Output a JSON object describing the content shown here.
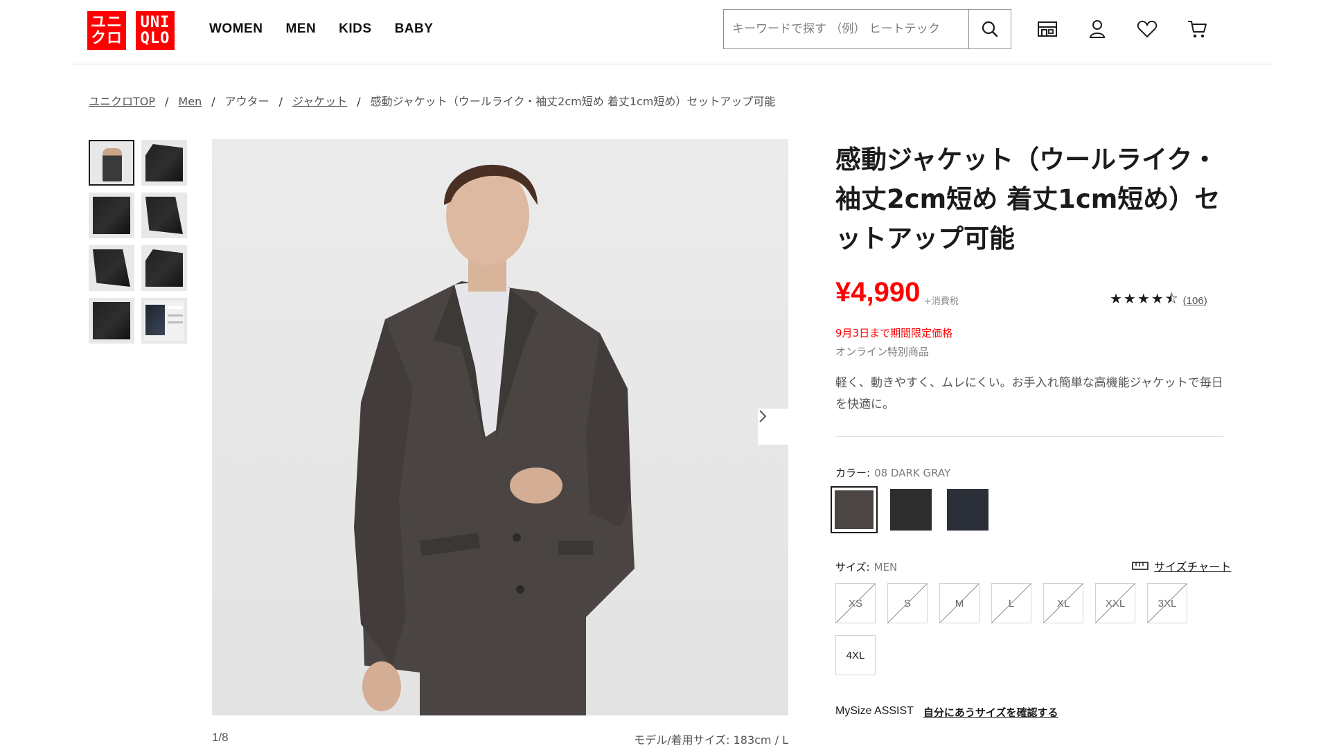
{
  "header": {
    "logo": {
      "top": "UNI\nQLO",
      "jp": "ユニ\nクロ",
      "brand_color": "#ff0000"
    },
    "nav": [
      "WOMEN",
      "MEN",
      "KIDS",
      "BABY"
    ],
    "search_placeholder": "キーワードで探す （例） ヒートテック",
    "icons": [
      "search-icon",
      "store-icon",
      "account-icon",
      "heart-icon",
      "cart-icon"
    ]
  },
  "breadcrumb": {
    "items": [
      "ユニクロTOP",
      "Men",
      "アウター",
      "ジャケット"
    ],
    "current": "感動ジャケット（ウールライク・袖丈2cm短め 着丈1cm短め）セットアップ可能"
  },
  "gallery": {
    "counter": "1/8",
    "model_size": "モデル/着用サイズ: 183cm / L"
  },
  "product": {
    "title": "感動ジャケット（ウールライク・袖丈2cm短め 着丈1cm短め）セットアップ可能",
    "price": "¥4,990",
    "tax_note": "+消費税",
    "rating_stars": "★★★★⯪",
    "rating_value": 4.5,
    "review_count": "(106)",
    "limited_price_note": "9月3日まで期間限定価格",
    "online_note": "オンライン特別商品",
    "description": "軽く、動きやすく、ムレにくい。お手入れ簡単な高機能ジャケットで毎日を快適に。",
    "accent_color": "#ff0000"
  },
  "color": {
    "label": "カラー:",
    "selected": "08 DARK GRAY",
    "swatches": [
      "#4b4644",
      "#2d2d2d",
      "#2b2f38"
    ]
  },
  "size": {
    "label": "サイズ:",
    "category": "MEN",
    "chart_link": "サイズチャート",
    "options": [
      {
        "label": "XS",
        "available": false
      },
      {
        "label": "S",
        "available": false
      },
      {
        "label": "M",
        "available": false
      },
      {
        "label": "L",
        "available": false
      },
      {
        "label": "XL",
        "available": false
      },
      {
        "label": "XXL",
        "available": false
      },
      {
        "label": "3XL",
        "available": false
      },
      {
        "label": "4XL",
        "available": true
      }
    ]
  },
  "mysize": {
    "label": "MySize ASSIST",
    "link": "自分にあうサイズを確認する"
  }
}
